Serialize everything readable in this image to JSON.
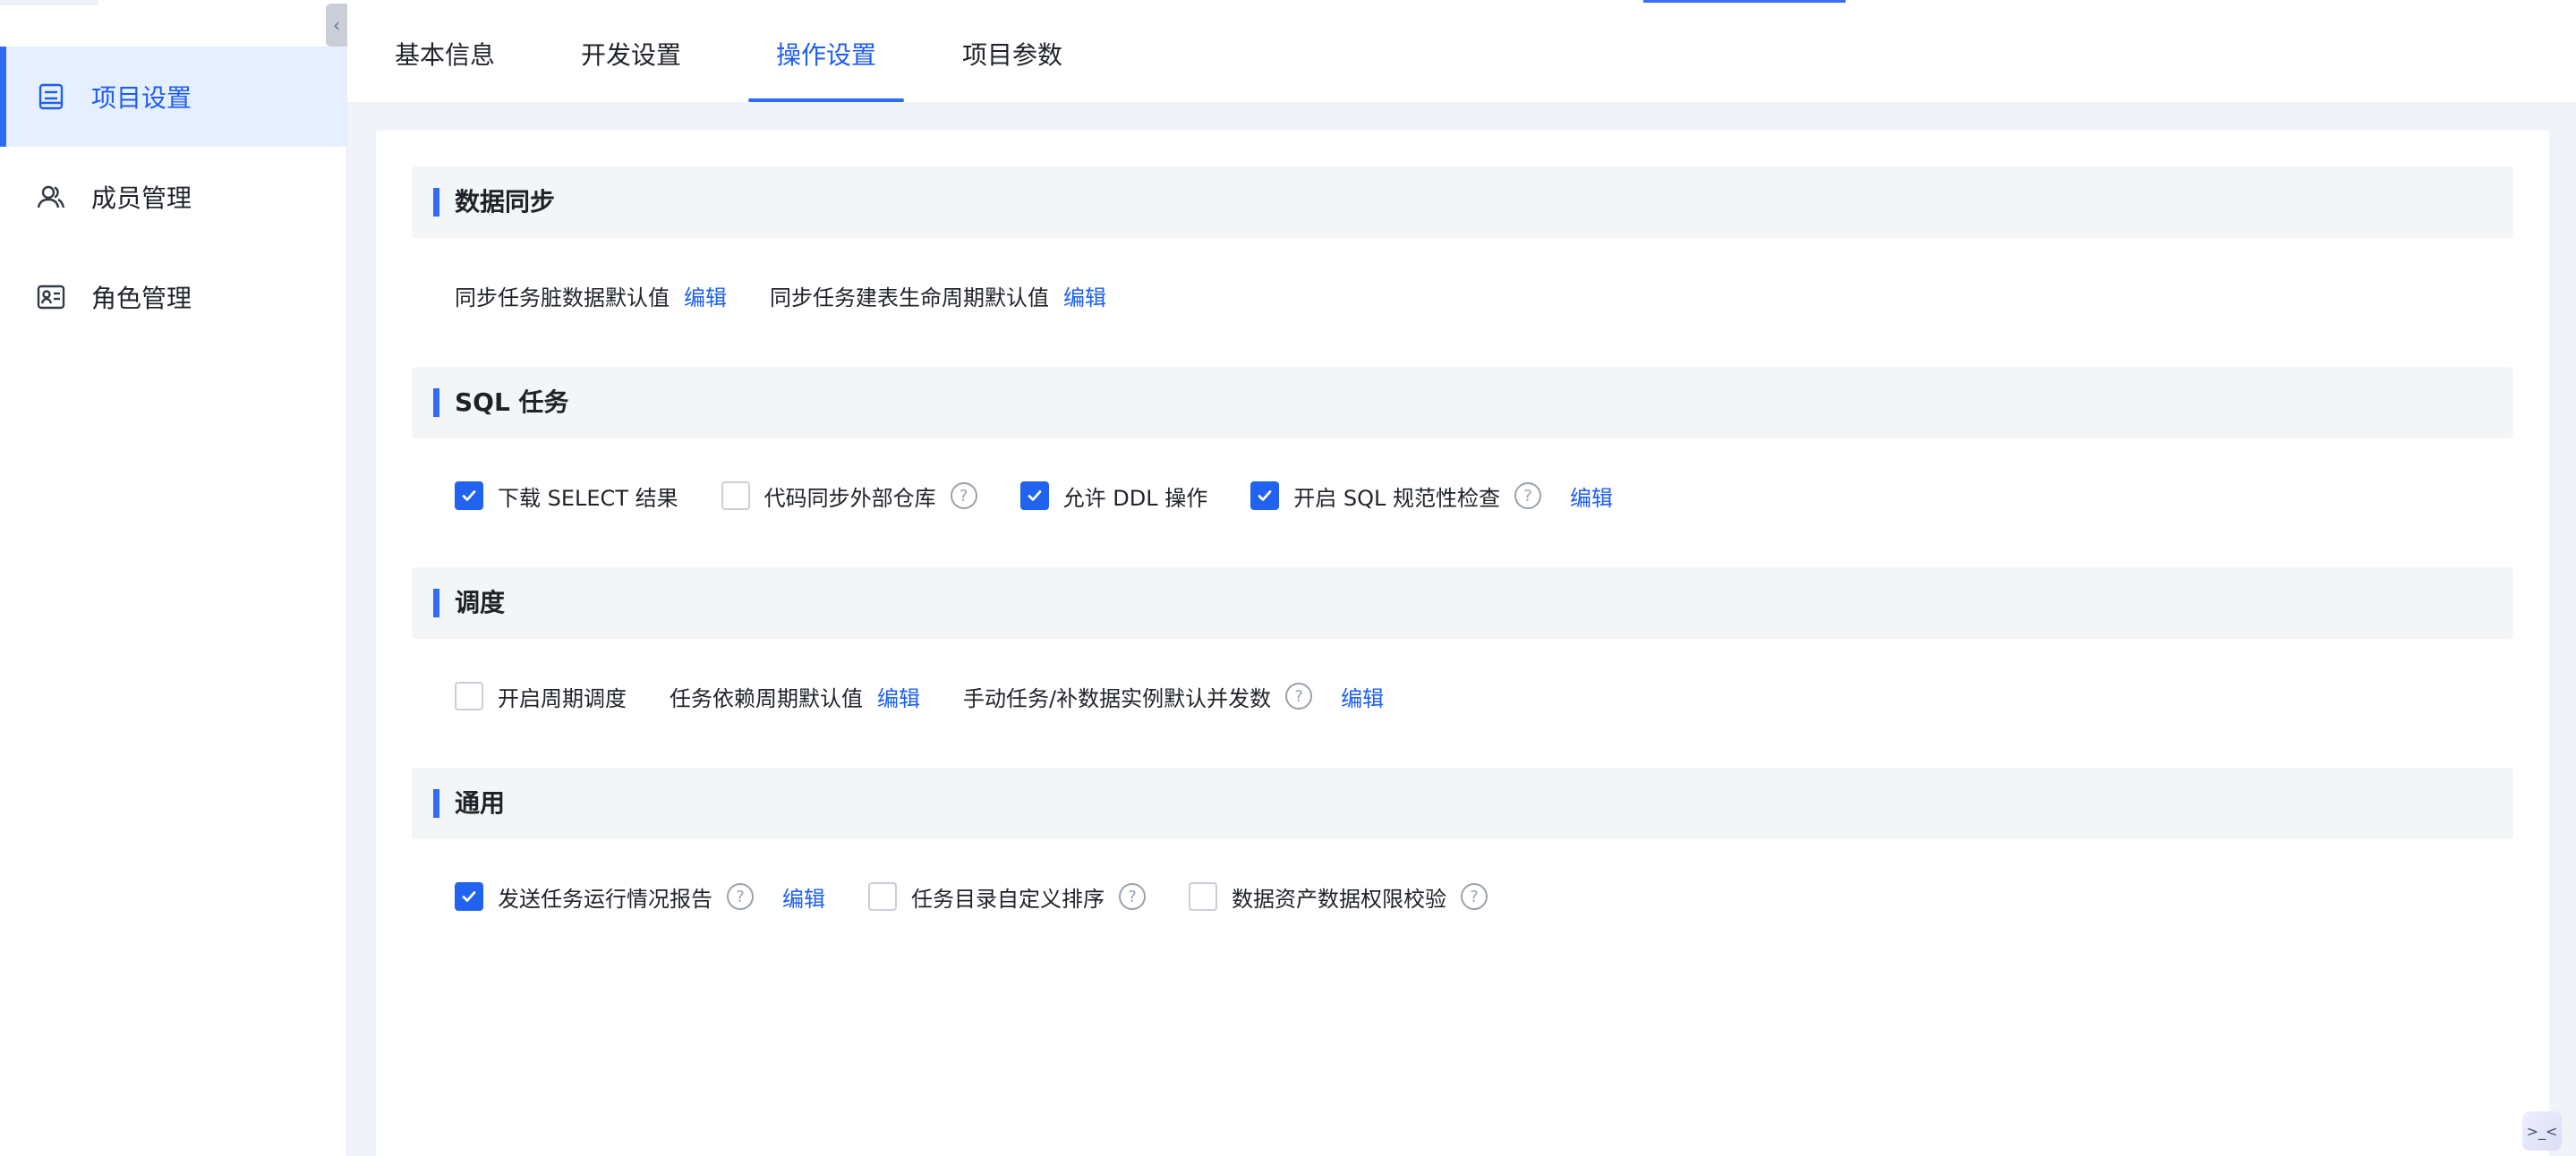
{
  "sidebar": {
    "collapse_glyph": "‹",
    "items": [
      {
        "label": "项目设置",
        "icon": "project-settings-icon",
        "active": true
      },
      {
        "label": "成员管理",
        "icon": "members-icon",
        "active": false
      },
      {
        "label": "角色管理",
        "icon": "role-card-icon",
        "active": false
      }
    ]
  },
  "tabs": [
    {
      "label": "基本信息",
      "active": false
    },
    {
      "label": "开发设置",
      "active": false
    },
    {
      "label": "操作设置",
      "active": true
    },
    {
      "label": "项目参数",
      "active": false
    }
  ],
  "sections": {
    "data_sync": {
      "title": "数据同步",
      "dirty_data_label": "同步任务脏数据默认值",
      "dirty_data_edit": "编辑",
      "lifecycle_label": "同步任务建表生命周期默认值",
      "lifecycle_edit": "编辑"
    },
    "sql_task": {
      "title": "SQL 任务",
      "download_select": {
        "label": "下载 SELECT 结果",
        "checked": true
      },
      "code_sync": {
        "label": "代码同步外部仓库",
        "checked": false
      },
      "allow_ddl": {
        "label": "允许 DDL 操作",
        "checked": true
      },
      "sql_check": {
        "label": "开启 SQL 规范性检查",
        "checked": true
      },
      "sql_check_edit": "编辑"
    },
    "schedule": {
      "title": "调度",
      "periodic": {
        "label": "开启周期调度",
        "checked": false
      },
      "dependency_label": "任务依赖周期默认值",
      "dependency_edit": "编辑",
      "concurrency_label": "手动任务/补数据实例默认并发数",
      "concurrency_edit": "编辑"
    },
    "general": {
      "title": "通用",
      "report": {
        "label": "发送任务运行情况报告",
        "checked": true
      },
      "report_edit": "编辑",
      "custom_sort": {
        "label": "任务目录自定义排序",
        "checked": false
      },
      "permission_check": {
        "label": "数据资产数据权限校验",
        "checked": false
      }
    }
  },
  "help_glyph": "?",
  "float_button_glyph": ">_<",
  "colors": {
    "accent": "#2f6cf6",
    "link": "#1d5ef2",
    "active_bg": "#e6efff",
    "section_bg": "#f4f5f7",
    "page_bg": "#f0f3f7"
  }
}
